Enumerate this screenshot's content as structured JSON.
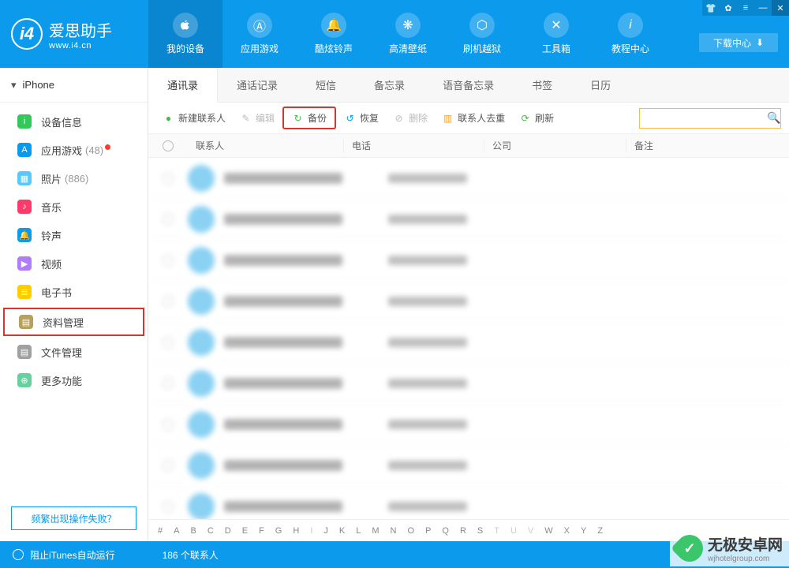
{
  "app": {
    "title": "爱思助手",
    "url": "www.i4.cn",
    "download_center": "下载中心"
  },
  "top_nav": [
    {
      "label": "我的设备",
      "icon": "apple"
    },
    {
      "label": "应用游戏",
      "icon": "app"
    },
    {
      "label": "酷炫铃声",
      "icon": "bell"
    },
    {
      "label": "高清壁纸",
      "icon": "wallpaper"
    },
    {
      "label": "刷机越狱",
      "icon": "box"
    },
    {
      "label": "工具箱",
      "icon": "wrench"
    },
    {
      "label": "教程中心",
      "icon": "info"
    }
  ],
  "sidebar": {
    "device": "iPhone",
    "items": [
      {
        "label": "设备信息",
        "color": "#34c759",
        "icon": "i"
      },
      {
        "label": "应用游戏",
        "count": "(48)",
        "color": "#0b9aec",
        "icon": "A",
        "dot": true
      },
      {
        "label": "照片",
        "count": "(886)",
        "color": "#5ac8fa",
        "icon": "▦"
      },
      {
        "label": "音乐",
        "color": "#ff3b6b",
        "icon": "♪"
      },
      {
        "label": "铃声",
        "color": "#0b9aec",
        "icon": "🔔"
      },
      {
        "label": "视频",
        "color": "#b07cf7",
        "icon": "▶"
      },
      {
        "label": "电子书",
        "color": "#ffcc00",
        "icon": "≣"
      },
      {
        "label": "资料管理",
        "color": "#b8a15a",
        "icon": "▤",
        "highlighted": true
      },
      {
        "label": "文件管理",
        "color": "#a0a0a0",
        "icon": "▤"
      },
      {
        "label": "更多功能",
        "color": "#66d19e",
        "icon": "⊕"
      }
    ],
    "faq": "频繁出现操作失败？"
  },
  "subtabs": [
    "通讯录",
    "通话记录",
    "短信",
    "备忘录",
    "语音备忘录",
    "书签",
    "日历"
  ],
  "toolbar": {
    "new_contact": "新建联系人",
    "edit": "编辑",
    "backup": "备份",
    "restore": "恢复",
    "delete": "删除",
    "dedupe": "联系人去重",
    "refresh": "刷新"
  },
  "table": {
    "headers": {
      "contact": "联系人",
      "phone": "电话",
      "company": "公司",
      "note": "备注"
    }
  },
  "alphabet": [
    "#",
    "A",
    "B",
    "C",
    "D",
    "E",
    "F",
    "G",
    "H",
    "I",
    "J",
    "K",
    "L",
    "M",
    "N",
    "O",
    "P",
    "Q",
    "R",
    "S",
    "T",
    "U",
    "V",
    "W",
    "X",
    "Y",
    "Z"
  ],
  "alphabet_faded": [
    "I",
    "T",
    "U",
    "V"
  ],
  "footer": {
    "prevent_itunes": "阻止iTunes自动运行",
    "contact_count": "186 个联系人"
  },
  "watermark": {
    "brand": "无极安卓网",
    "url": "wjhotelgroup.com"
  }
}
